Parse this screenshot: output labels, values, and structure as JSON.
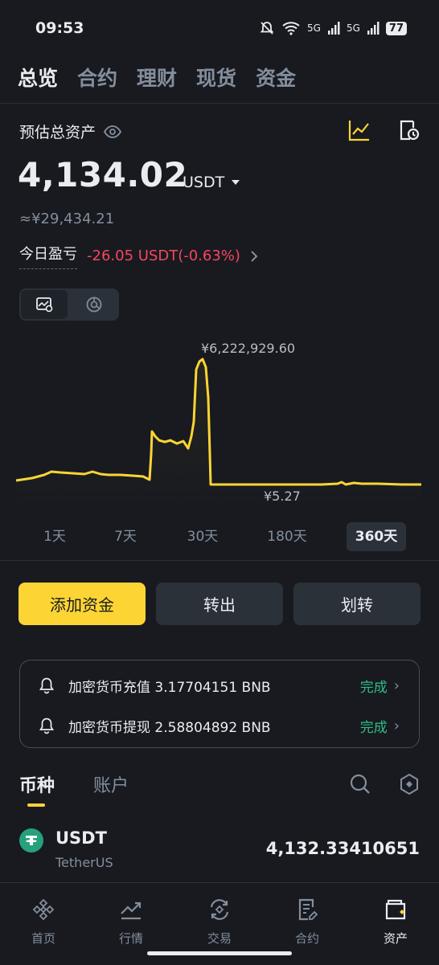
{
  "status": {
    "time": "09:53",
    "net1": "5G",
    "net2": "5G",
    "battery": "77"
  },
  "top_tabs": [
    {
      "label": "总览",
      "active": true
    },
    {
      "label": "合约",
      "active": false
    },
    {
      "label": "理财",
      "active": false
    },
    {
      "label": "现货",
      "active": false
    },
    {
      "label": "资金",
      "active": false
    }
  ],
  "header": {
    "est_label": "预估总资产",
    "total_value": "4,134.02",
    "unit": "USDT",
    "approx": "≈¥29,434.21",
    "pnl_label": "今日盈亏",
    "pnl_value": "-26.05 USDT(-0.63%)"
  },
  "chart": {
    "max_label": "¥6,222,929.60",
    "min_label": "¥5.27",
    "line_color": "#FCD535"
  },
  "periods": [
    {
      "label": "1天",
      "active": false
    },
    {
      "label": "7天",
      "active": false
    },
    {
      "label": "30天",
      "active": false
    },
    {
      "label": "180天",
      "active": false
    },
    {
      "label": "360天",
      "active": true
    }
  ],
  "actions": {
    "add_funds": "添加资金",
    "withdraw": "转出",
    "transfer": "划转"
  },
  "notifications": [
    {
      "text": "加密货币充值 3.17704151 BNB",
      "status": "完成"
    },
    {
      "text": "加密货币提现 2.58804892 BNB",
      "status": "完成"
    }
  ],
  "asset_tabs": {
    "coins": "币种",
    "accounts": "账户"
  },
  "assets": [
    {
      "symbol": "USDT",
      "name": "TetherUS",
      "balance": "4,132.33410651"
    }
  ],
  "bottom_nav": [
    {
      "label": "首页",
      "icon": "binance-logo-icon",
      "active": false
    },
    {
      "label": "行情",
      "icon": "market-chart-icon",
      "active": false
    },
    {
      "label": "交易",
      "icon": "trade-exchange-icon",
      "active": false
    },
    {
      "label": "合约",
      "icon": "futures-document-icon",
      "active": false
    },
    {
      "label": "资产",
      "icon": "wallet-icon",
      "active": true
    }
  ],
  "colors": {
    "accent": "#FCD535",
    "negative": "#F6465D",
    "positive": "#2EBD85",
    "background": "#181A20"
  }
}
